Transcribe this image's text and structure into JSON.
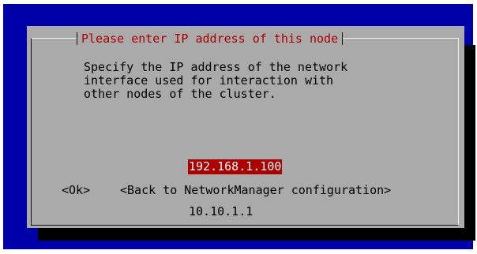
{
  "dialog": {
    "title": "Please enter IP address of this node",
    "description_lines": [
      "Specify the IP address of the network",
      "interface used for interaction with",
      "other nodes of the cluster."
    ],
    "ip_options": [
      {
        "label": "192.168.1.100",
        "selected": true
      },
      {
        "label": "10.10.1.1",
        "selected": false
      }
    ],
    "buttons": {
      "ok": "<Ok>",
      "back": "<Back to NetworkManager configuration>"
    }
  },
  "colors": {
    "background": "#0000aa",
    "dialog": "#aaaaaa",
    "title": "#aa0000",
    "selection": "#aa0000",
    "shadow": "#000000"
  }
}
